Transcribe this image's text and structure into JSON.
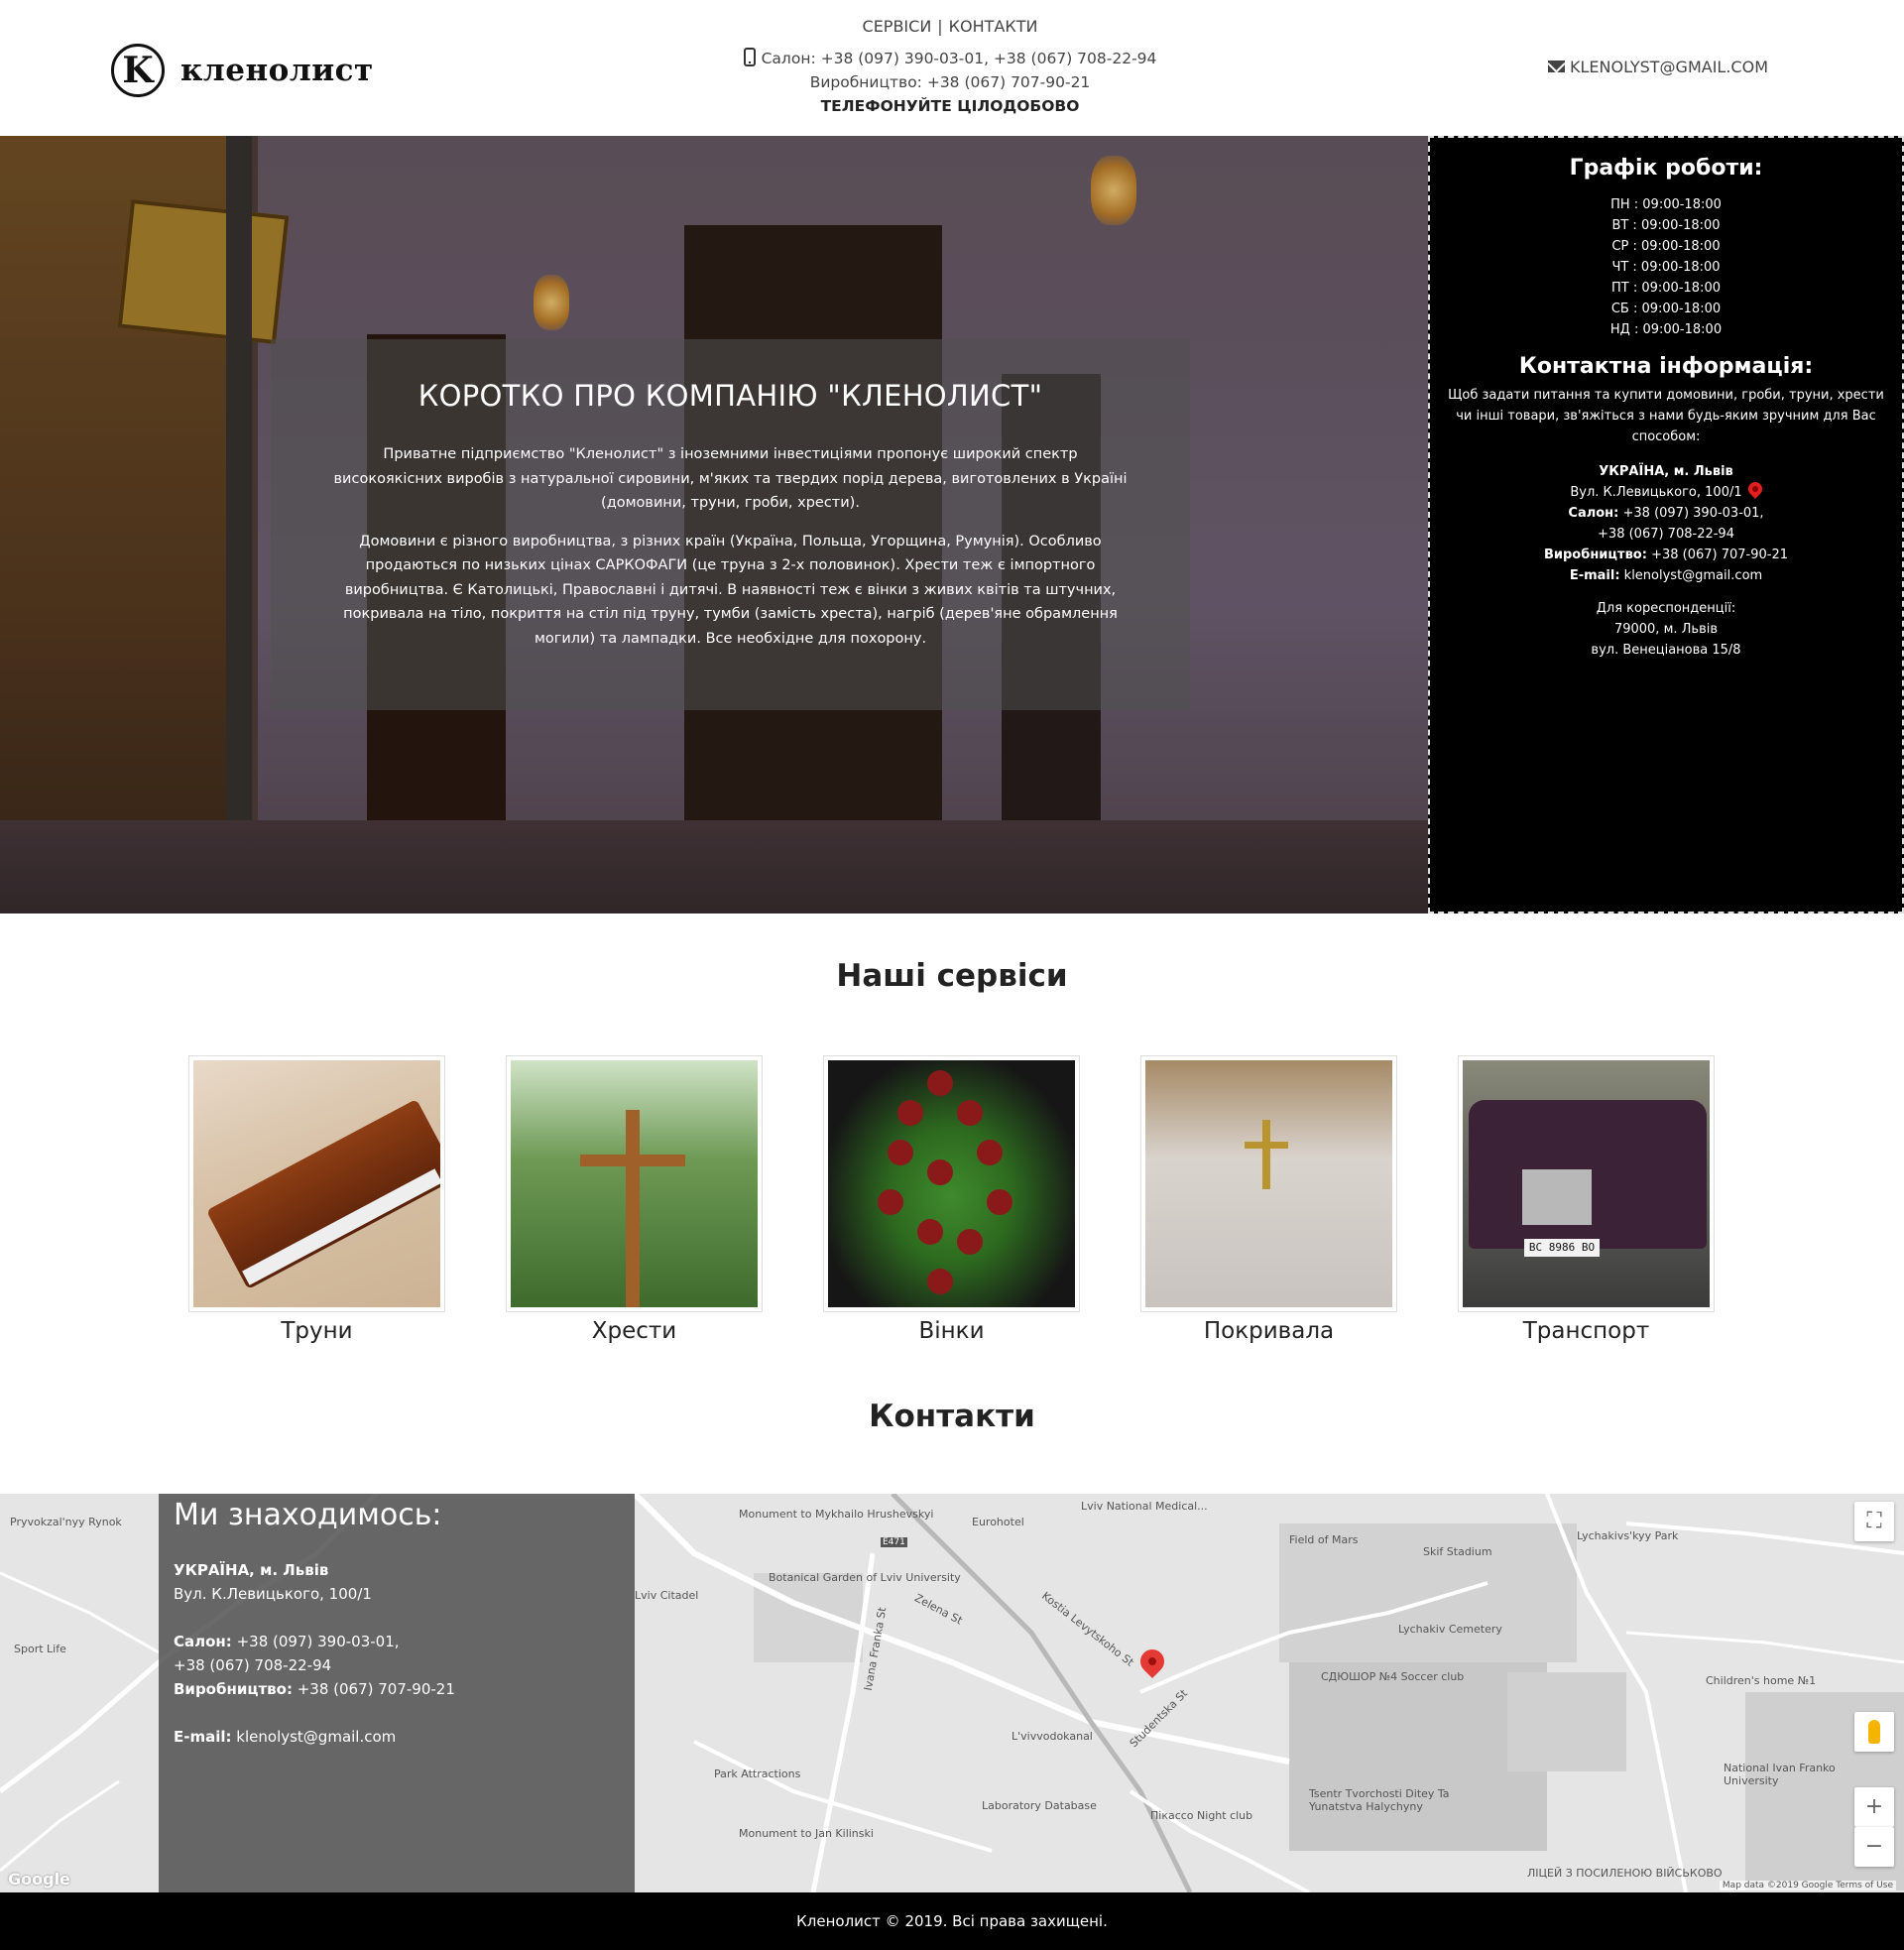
{
  "header": {
    "logo_mark": "K",
    "logo_text": "кленолист",
    "nav": [
      "СЕРВІСИ",
      "КОНТАКТИ"
    ],
    "nav_separator": "|",
    "salon_phones": "Салон: +38 (097) 390-03-01, +38 (067) 708-22-94",
    "production_phone": "Виробництво: +38 (067) 707-90-21",
    "call_note": "ТЕЛЕФОНУЙТЕ ЦІЛОДОБОВО",
    "email": "KLENOLYST@GMAIL.COM"
  },
  "about": {
    "title": "КОРОТКО ПРО КОМПАНІЮ \"КЛЕНОЛИСТ\"",
    "p1": "Приватне підприємство \"Кленолист\" з іноземними інвестиціями пропонує широкий спектр високоякісних виробів з натуральної сировини, м'яких та твердих порід дерева, виготовлених в Україні (домовини, труни, гроби, хрести).",
    "p2": "Домовини є різного виробництва, з різних країн (Україна, Польща, Угорщина, Румунія). Особливо продаються по низьких цінах САРКОФАГИ (це труна з 2-х половинок). Хрести теж є імпортного виробництва. Є Католицькі, Православні і дитячі. В наявності теж є вінки з живих квітів та штучних, покривала на тіло, покриття на стіл під труну, тумби (замість хреста), нагріб (дерев'яне обрамлення могили) та лампадки. Все необхідне для похорону."
  },
  "schedule": {
    "title": "Графік роботи:",
    "days": [
      "ПН : 09:00-18:00",
      "ВТ : 09:00-18:00",
      "СР : 09:00-18:00",
      "ЧТ : 09:00-18:00",
      "ПТ : 09:00-18:00",
      "СБ : 09:00-18:00",
      "НД : 09:00-18:00"
    ],
    "contact_title": "Контактна інформація:",
    "contact_intro": "Щоб задати питання та купити домовини, гроби, труни, хрести чи інші товари, зв'яжіться з нами будь-яким зручним для Вас способом:",
    "country_city": "УКРАЇНА, м. Львів",
    "address": "Вул. К.Левицького, 100/1",
    "salon_label": "Салон:",
    "salon_phone1": "+38 (097) 390-03-01,",
    "salon_phone2": "+38 (067) 708-22-94",
    "production_label": "Виробництво:",
    "production_phone": "+38 (067) 707-90-21",
    "email_label": "E-mail:",
    "email": "klenolyst@gmail.com",
    "corr_label": "Для кореспонденції:",
    "corr_city": "79000, м. Львів",
    "corr_street": "вул. Венеціанова 15/8"
  },
  "services": {
    "title": "Наші сервіси",
    "items": [
      "Труни",
      "Хрести",
      "Вінки",
      "Покривала",
      "Транспорт"
    ],
    "car_plate": "BC 8986 BO"
  },
  "contacts": {
    "title": "Контакти",
    "locate_title": "Ми знаходимось:",
    "country_city": "УКРАЇНА, м. Львів",
    "address": "Вул. К.Левицького, 100/1",
    "salon_label": "Салон:",
    "salon_phone1": "+38 (097) 390-03-01,",
    "salon_phone2": "+38 (067) 708-22-94",
    "production_label": "Виробництво:",
    "production_phone": "+38 (067) 707-90-21",
    "email_label": "E-mail:",
    "email": "klenolyst@gmail.com"
  },
  "map": {
    "labels": [
      "Lviv National Medical...",
      "Monument to Mykhailo Hrushevskyi",
      "Eurohotel",
      "Field of Mars",
      "Skif Stadium",
      "Lychakivs'kyy Park",
      "Botanical Garden of Lviv University",
      "Lviv Citadel",
      "Lychakiv Cemetery",
      "Children's home №1",
      "Park Attractions",
      "L'vivvodokanal",
      "Laboratory Database",
      "Tsentr Tvorchosti Ditey Ta Yunatstva Halychyny",
      "Monument to Jan Kilinski",
      "Pryvokzal'nyy Rynok",
      "Sport Life",
      "National Ivan Franko University",
      "Zelena St",
      "Kostia Levytskoho St",
      "Studentska St",
      "Ivana Franka St",
      "E471",
      "Пікассо Night club",
      "СДЮШОР №4 Soccer club",
      "ЛІЦЕЙ З ПОСИЛЕНОЮ ВІЙСЬКОВО"
    ],
    "google_logo": "Google",
    "terms": "Map data ©2019 Google   Terms of Use",
    "zoom_in": "+",
    "zoom_out": "−",
    "fullscreen": "⛶"
  },
  "footer": {
    "copyright": "Кленолист © 2019. Всі права захищені."
  }
}
